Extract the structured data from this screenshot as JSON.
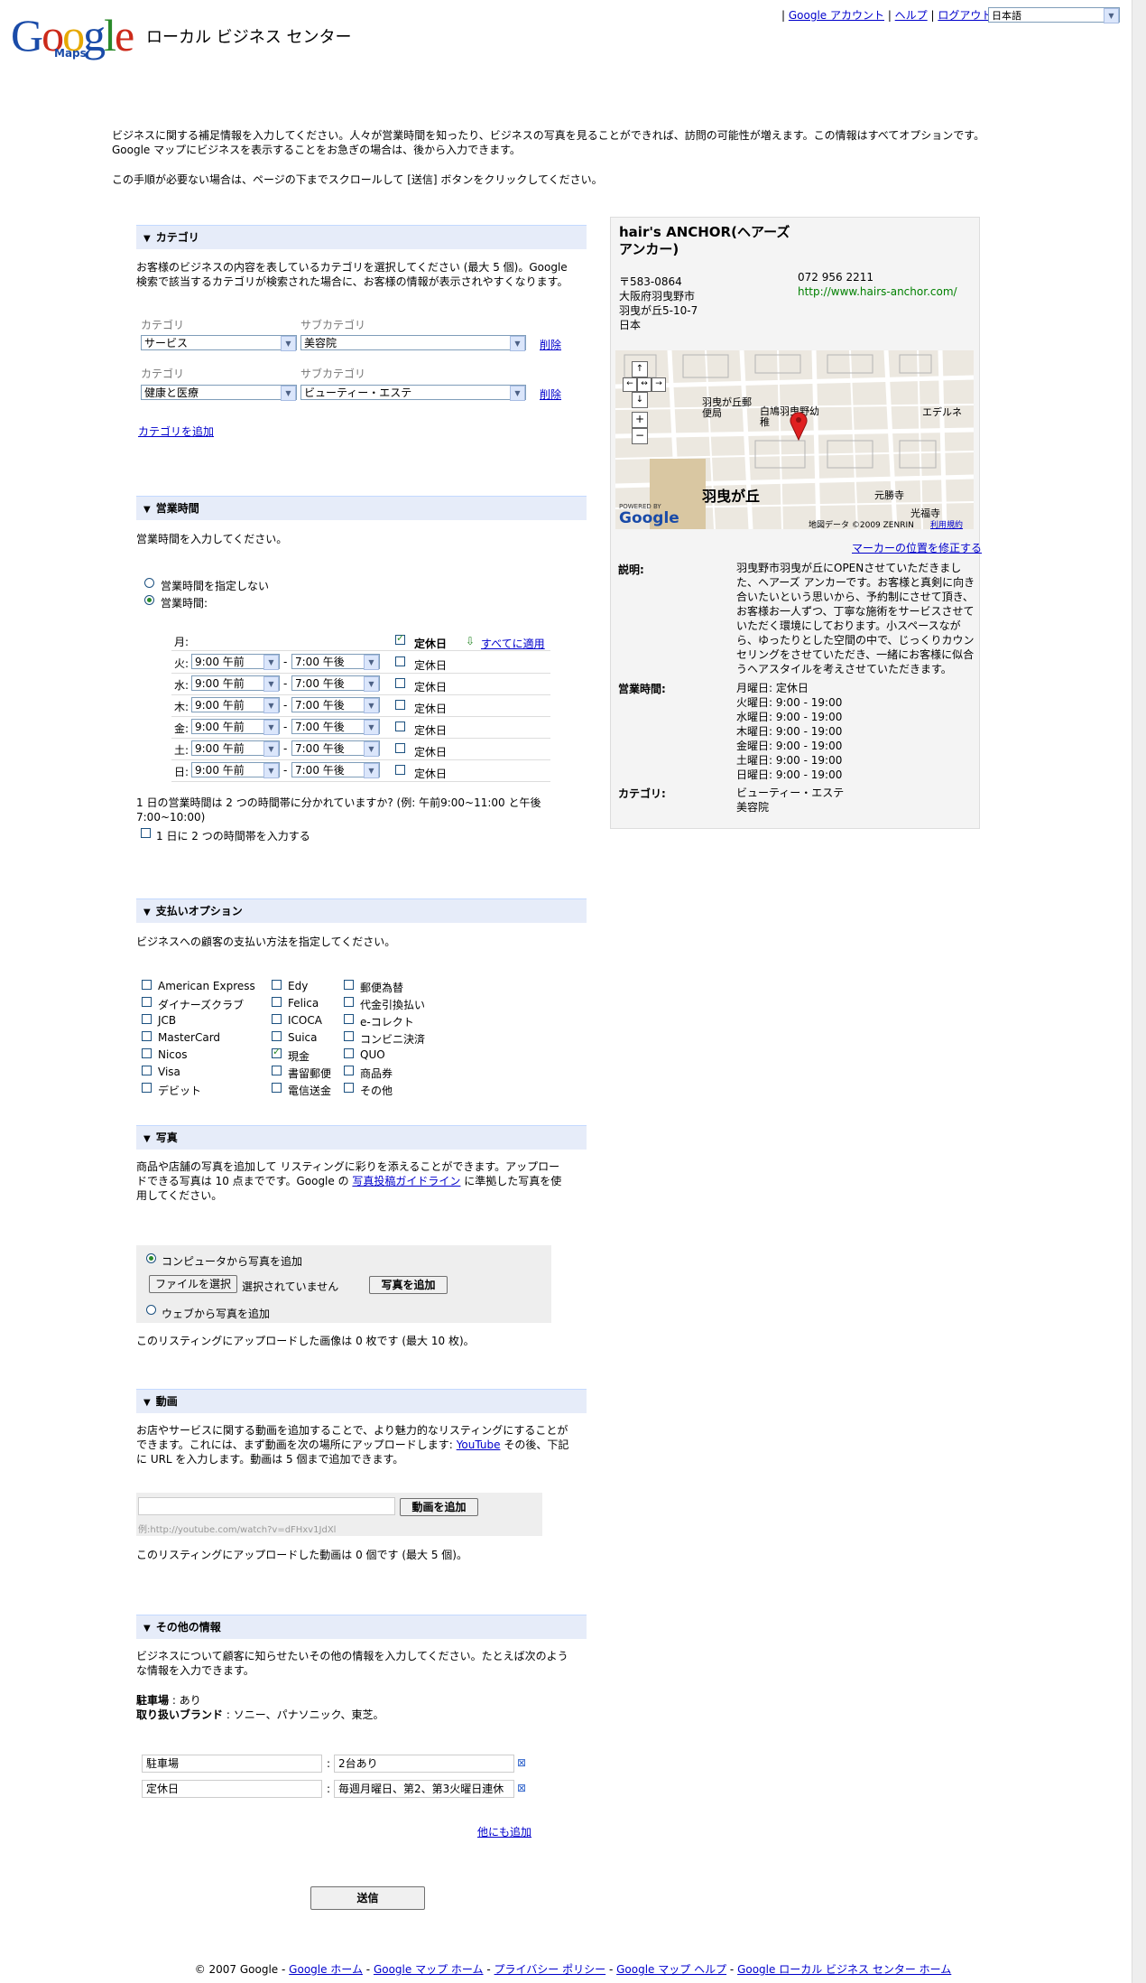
{
  "header": {
    "logo_text": "Google",
    "logo_sub": "Maps",
    "product": "ローカル ビジネス センター",
    "links": [
      "Google アカウント",
      "ヘルプ",
      "ログアウト"
    ],
    "language": "日本語"
  },
  "intro": {
    "p1": "ビジネスに関する補足情報を入力してください。人々が営業時間を知ったり、ビジネスの写真を見ることができれば、訪問の可能性が増えます。この情報はすべてオプションです。Google マップにビジネスを表示することをお急ぎの場合は、後から入力できます。",
    "p2": "この手順が必要ない場合は、ページの下までスクロールして [送信] ボタンをクリックしてください。"
  },
  "category": {
    "title": "カテゴリ",
    "desc": "お客様のビジネスの内容を表しているカテゴリを選択してください (最大 5 個)。Google 検索で該当するカテゴリが検索された場合に、お客様の情報が表示されやすくなります。",
    "label_cat": "カテゴリ",
    "label_sub": "サブカテゴリ",
    "rows": [
      {
        "cat": "サービス",
        "sub": "美容院",
        "delete": "削除"
      },
      {
        "cat": "健康と医療",
        "sub": "ビューティー・エステ",
        "delete": "削除"
      }
    ],
    "add": "カテゴリを追加"
  },
  "hours": {
    "title": "営業時間",
    "desc": "営業時間を入力してください。",
    "opt_none": "営業時間を指定しない",
    "opt_hours": "営業時間:",
    "closed": "定休日",
    "apply_all": "すべてに適用",
    "mon": "月:",
    "days": [
      {
        "day": "火:",
        "open": "9:00 午前",
        "close": "7:00 午後"
      },
      {
        "day": "水:",
        "open": "9:00 午前",
        "close": "7:00 午後"
      },
      {
        "day": "木:",
        "open": "9:00 午前",
        "close": "7:00 午後"
      },
      {
        "day": "金:",
        "open": "9:00 午前",
        "close": "7:00 午後"
      },
      {
        "day": "土:",
        "open": "9:00 午前",
        "close": "7:00 午後"
      },
      {
        "day": "日:",
        "open": "9:00 午前",
        "close": "7:00 午後"
      }
    ],
    "dash": "-",
    "split_q": "1 日の営業時間は 2 つの時間帯に分かれていますか? (例: 午前9:00~11:00 と午後7:00~10:00)",
    "split_cb": "1 日に 2 つの時間帯を入力する"
  },
  "payment": {
    "title": "支払いオプション",
    "desc": "ビジネスへの顧客の支払い方法を指定してください。",
    "col1": [
      "American Express",
      "ダイナーズクラブ",
      "JCB",
      "MasterCard",
      "Nicos",
      "Visa",
      "デビット"
    ],
    "col2": [
      "Edy",
      "Felica",
      "ICOCA",
      "Suica",
      "現金",
      "書留郵便",
      "電信送金"
    ],
    "col3": [
      "郵便為替",
      "代金引換払い",
      "e-コレクト",
      "コンビニ決済",
      "QUO",
      "商品券",
      "その他"
    ],
    "checked": "現金"
  },
  "photos": {
    "title": "写真",
    "desc_a": "商品や店舗の写真を追加して リスティングに彩りを添えることができます。アップロードできる写真は 10 点までです。Google の",
    "desc_link": "写真投稿ガイドライン",
    "desc_b": "に準拠した写真を使用してください。",
    "opt_computer": "コンピュータから写真を追加",
    "choose_file": "ファイルを選択",
    "no_file": "選択されていません",
    "add_photo": "写真を追加",
    "opt_web": "ウェブから写真を追加",
    "count": "このリスティングにアップロードした画像は 0 枚です (最大 10 枚)。"
  },
  "video": {
    "title": "動画",
    "desc_a": "お店やサービスに関する動画を追加することで、より魅力的なリスティングにすることができます。これには、まず動画を次の場所にアップロードします:",
    "desc_link": "YouTube",
    "desc_b": "その後、下記に URL を入力します。動画は 5 個まで追加できます。",
    "add_video": "動画を追加",
    "example": "例:http://youtube.com/watch?v=dFHxv1JdXl",
    "count": "このリスティングにアップロードした動画は 0 個です (最大 5 個)。"
  },
  "other": {
    "title": "その他の情報",
    "desc": "ビジネスについて顧客に知らせたいその他の情報を入力してください。たとえば次のような情報を入力できます。",
    "ex1_label": "駐車場",
    "ex1_val": ": あり",
    "ex2_label": "取り扱いブランド",
    "ex2_val": ": ソニー、パナソニック、東芝。",
    "rows": [
      {
        "key": "駐車場",
        "val": "2台あり"
      },
      {
        "key": "定休日",
        "val": "毎週月曜日、第2、第3火曜日連休"
      }
    ],
    "colon": ":",
    "add_more": "他にも追加"
  },
  "submit": "送信",
  "listing": {
    "name": "hair's ANCHOR(ヘアーズ アンカー)",
    "address": [
      "〒583-0864",
      "大阪府羽曳野市",
      "羽曳が丘5-10-7",
      "日本"
    ],
    "phone": "072 956 2211",
    "url": "http://www.hairs-anchor.com/",
    "fix_marker": "マーカーの位置を修正する",
    "desc_label": "説明:",
    "desc": "羽曳野市羽曳が丘にOPENさせていただきました、ヘアーズ アンカーです。お客様と真剣に向き合いたいという思いから、予約制にさせて頂き、お客様お一人ずつ、丁寧な施術をサービスさせていただく環境にしております。小スペースながら、ゆったりとした空間の中で、じっくりカウンセリングをさせていただき、一緒にお客様に似合うヘアスタイルを考えさせていただきます。",
    "hours_label": "営業時間:",
    "hours": [
      "月曜日: 定休日",
      "火曜日: 9:00 - 19:00",
      "水曜日: 9:00 - 19:00",
      "木曜日: 9:00 - 19:00",
      "金曜日: 9:00 - 19:00",
      "土曜日: 9:00 - 19:00",
      "日曜日: 9:00 - 19:00"
    ],
    "cat_label": "カテゴリ:",
    "cats": [
      "ビューティー・エステ",
      "美容院"
    ]
  },
  "map": {
    "labels": [
      "羽曳が丘郵便局",
      "白鳩羽曳野幼稚",
      "エデルネ",
      "羽曳が丘",
      "元勝寺",
      "光福寺"
    ],
    "copyright": "地図データ ©2009 ZENRIN",
    "terms": "利用規約",
    "powered": "POWERED BY",
    "google": "Google"
  },
  "footer": {
    "copy": "© 2007 Google -",
    "links": [
      "Google ホーム",
      "Google マップ ホーム",
      "プライバシー ポリシー",
      "Google マップ ヘルプ",
      "Google ローカル ビジネス センター ホーム"
    ],
    "sep": "-"
  },
  "colors": {
    "link": "#0000cc",
    "section_bg": "#e6ecf9",
    "url_green": "#008000"
  }
}
